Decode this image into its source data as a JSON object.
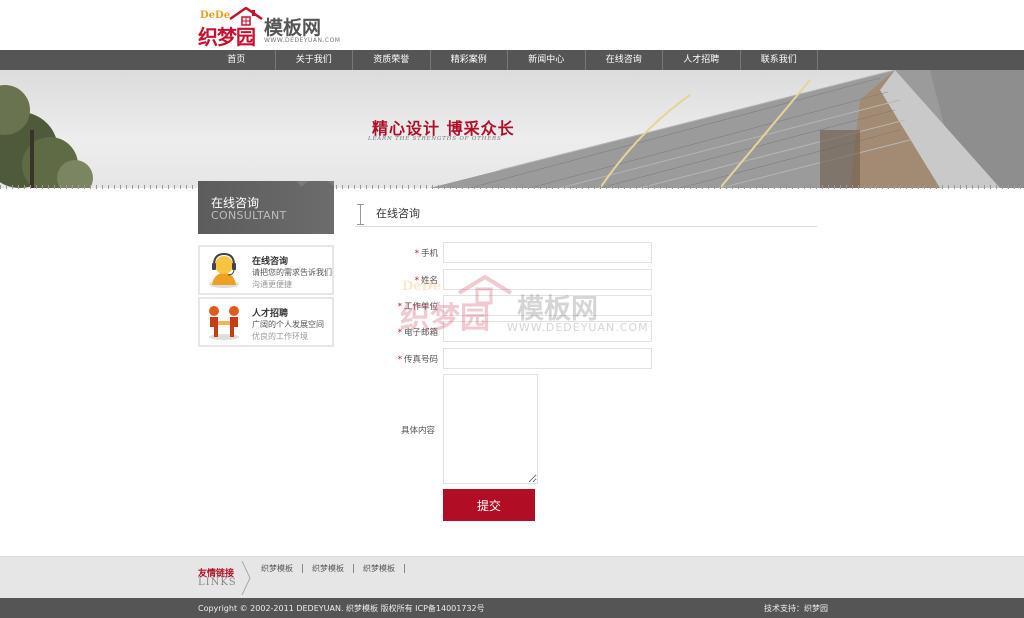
{
  "brand": {
    "dede": "DeDe",
    "name_cn": "织梦园",
    "subtitle": "模板网",
    "url": "WWW.DEDEYUAN.COM"
  },
  "nav": {
    "items": [
      {
        "label": "首页"
      },
      {
        "label": "关于我们"
      },
      {
        "label": "资质荣誉"
      },
      {
        "label": "精彩案例"
      },
      {
        "label": "新闻中心"
      },
      {
        "label": "在线咨询"
      },
      {
        "label": "人才招聘"
      },
      {
        "label": "联系我们"
      }
    ]
  },
  "banner": {
    "slogan": "精心设计 博采众长",
    "slogan_en": "LEARN THE STRENGTHS OF OTHERS"
  },
  "sidebar": {
    "title": "在线咨询",
    "title_en": "CONSULTANT",
    "boxes": [
      {
        "icon": "headset-person-icon",
        "title": "在线咨询",
        "line1": "请把您的需求告诉我们",
        "line2": "沟通更便捷"
      },
      {
        "icon": "handshake-icon",
        "title": "人才招聘",
        "line1": "广阔的个人发展空间",
        "line2": "优良的工作环境"
      }
    ]
  },
  "main": {
    "title": "在线咨询",
    "form": {
      "phone_label": "手机",
      "name_label": "姓名",
      "company_label": "工作单位",
      "email_label": "电子邮箱",
      "fax_label": "传真号码",
      "content_label": "具体内容",
      "required_mark": "*",
      "submit_label": "提交"
    },
    "watermark": {
      "dede": "DeDe",
      "name_cn": "织梦园",
      "subtitle": "模板网",
      "url": "WWW.DEDEYUAN.COM"
    }
  },
  "links": {
    "title": "友情链接",
    "title_en": "LINKS",
    "items": [
      {
        "label": "织梦模板"
      },
      {
        "label": "织梦模板"
      },
      {
        "label": "织梦模板"
      }
    ]
  },
  "footer": {
    "copyright": "Copyright © 2002-2011 DEDEYUAN. 织梦模板 版权所有 ICP备14001732号",
    "support": "技术支持：织梦园"
  },
  "colors": {
    "brand_red": "#b10e25",
    "nav_bg": "#555555",
    "accent_orange": "#e8a020"
  }
}
